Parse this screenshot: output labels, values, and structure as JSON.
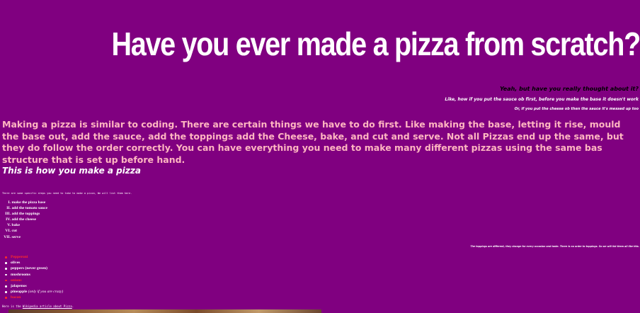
{
  "page": {
    "title": "Have you ever made a pizza from scratch?",
    "subtitle_1": "Yeah, but have you really thought about it?",
    "subtitle_2": "Like, how if you put the sauce ob first, before you make the base it doesn't work",
    "subtitle_3": "Or, if you put the cheese ob then the sauce it's messed up too",
    "intro": "Making a pizza is similar to coding. There are certain things we have to do first. Like making the base, letting it rise, mould the base out, add the sauce, add the toppings add the Cheese, bake, and cut and serve. Not all Pizzas end up the same, but they do follow the order correctly. You can have everything you need to make many different pizzas using the same bas structure that is set up before hand.",
    "howto_heading": "This is how you make a pizza",
    "steps_note": "There are some specific steps you need to take to make a pizza, We will list them here.",
    "steps": [
      {
        "num": "I.",
        "text": "make the pizza base"
      },
      {
        "num": "II.",
        "text": "add the tomato sauce"
      },
      {
        "num": "III.",
        "text": "add the toppings"
      },
      {
        "num": "IV.",
        "text": "add the cheese"
      },
      {
        "num": "V.",
        "text": "bake"
      },
      {
        "num": "VI.",
        "text": "cut"
      },
      {
        "num": "VII.",
        "text": "serve"
      }
    ],
    "toppings_note": "The toppings are different, they change for every occasion and taste. There is no order to toppings. So we will list them all like this.",
    "toppings": [
      {
        "text": "Pepperoni",
        "color": "#ff2a2a"
      },
      {
        "text": "olives",
        "color": "#ffffff"
      },
      {
        "text": "peppers (never green)",
        "color": "#ffffff"
      },
      {
        "text": "mushrooms",
        "color": "#ffffff"
      },
      {
        "text": "onions",
        "color": "#ff2a2a"
      },
      {
        "text": "jalapenos",
        "color": "#ffffff"
      },
      {
        "text": "pineapple",
        "note": "(only if you are crazy)",
        "color": "#ffffff"
      },
      {
        "text": "bacon",
        "color": "#ff2a2a"
      }
    ],
    "more_prefix": "Here is the ",
    "more_link": "Wikipedia article about Pizza",
    "more_suffix": "."
  },
  "colors": {
    "background": "#800080",
    "intro_text": "#ffb6c1",
    "accent_red": "#ff2a2a",
    "text": "#ffffff"
  }
}
